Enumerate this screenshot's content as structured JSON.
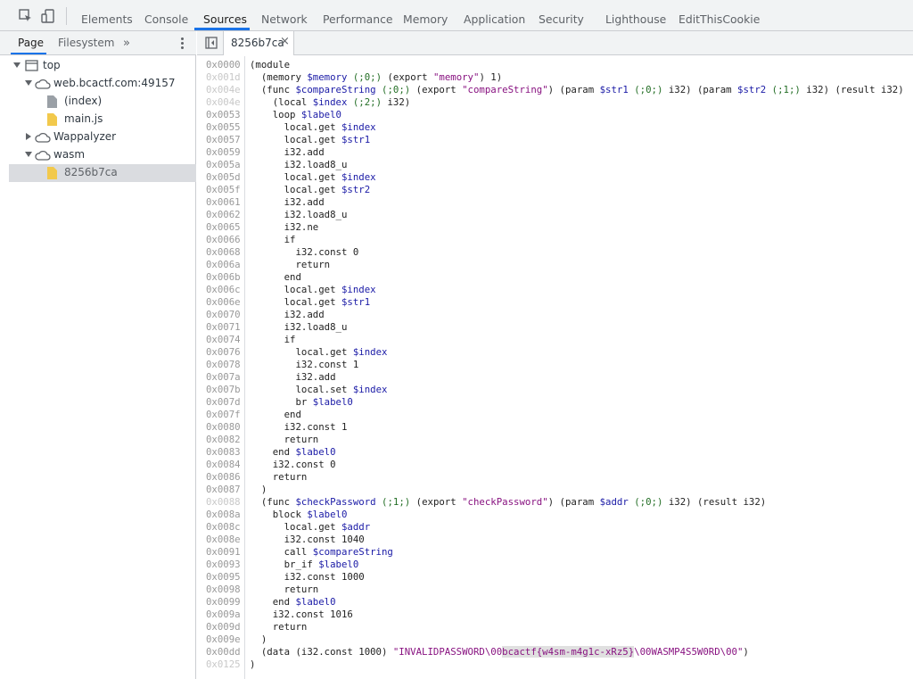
{
  "toolbar": {
    "tabs": [
      {
        "label": "Elements"
      },
      {
        "label": "Console"
      },
      {
        "label": "Sources"
      },
      {
        "label": "Network"
      },
      {
        "label": "Performance"
      },
      {
        "label": "Memory"
      },
      {
        "label": "Application"
      },
      {
        "label": "Security"
      },
      {
        "label": "Lighthouse"
      },
      {
        "label": "EditThisCookie"
      }
    ],
    "active_tab": "Sources",
    "accent_color": "#1a73e8"
  },
  "navigator": {
    "tabs": [
      {
        "label": "Page"
      },
      {
        "label": "Filesystem"
      }
    ],
    "more_label": "»",
    "tree": [
      {
        "label": "top",
        "icon": "frame-icon"
      },
      {
        "label": "web.bcactf.com:49157",
        "icon": "cloud-icon"
      },
      {
        "label": "(index)",
        "icon": "document-icon"
      },
      {
        "label": "main.js",
        "icon": "script-file-icon"
      },
      {
        "label": "Wappalyzer",
        "icon": "cloud-icon"
      },
      {
        "label": "wasm",
        "icon": "cloud-icon"
      },
      {
        "label": "8256b7ca",
        "icon": "script-file-icon"
      }
    ]
  },
  "editor": {
    "open_tab": "8256b7ca",
    "close_glyph": "×",
    "lines": [
      {
        "addr": "0x0000",
        "text": "(module"
      },
      {
        "addr": "0x001d",
        "text": "  (memory $memory (;0;) (export \"memory\") 1)"
      },
      {
        "addr": "0x004e",
        "text": "  (func $compareString (;0;) (export \"compareString\") (param $str1 (;0;) i32) (param $str2 (;1;) i32) (result i32)"
      },
      {
        "addr": "0x004e",
        "text": "    (local $index (;2;) i32)"
      },
      {
        "addr": "0x0053",
        "text": "    loop $label0"
      },
      {
        "addr": "0x0055",
        "text": "      local.get $index"
      },
      {
        "addr": "0x0057",
        "text": "      local.get $str1"
      },
      {
        "addr": "0x0059",
        "text": "      i32.add"
      },
      {
        "addr": "0x005a",
        "text": "      i32.load8_u"
      },
      {
        "addr": "0x005d",
        "text": "      local.get $index"
      },
      {
        "addr": "0x005f",
        "text": "      local.get $str2"
      },
      {
        "addr": "0x0061",
        "text": "      i32.add"
      },
      {
        "addr": "0x0062",
        "text": "      i32.load8_u"
      },
      {
        "addr": "0x0065",
        "text": "      i32.ne"
      },
      {
        "addr": "0x0066",
        "text": "      if"
      },
      {
        "addr": "0x0068",
        "text": "        i32.const 0"
      },
      {
        "addr": "0x006a",
        "text": "        return"
      },
      {
        "addr": "0x006b",
        "text": "      end"
      },
      {
        "addr": "0x006c",
        "text": "      local.get $index"
      },
      {
        "addr": "0x006e",
        "text": "      local.get $str1"
      },
      {
        "addr": "0x0070",
        "text": "      i32.add"
      },
      {
        "addr": "0x0071",
        "text": "      i32.load8_u"
      },
      {
        "addr": "0x0074",
        "text": "      if"
      },
      {
        "addr": "0x0076",
        "text": "        local.get $index"
      },
      {
        "addr": "0x0078",
        "text": "        i32.const 1"
      },
      {
        "addr": "0x007a",
        "text": "        i32.add"
      },
      {
        "addr": "0x007b",
        "text": "        local.set $index"
      },
      {
        "addr": "0x007d",
        "text": "        br $label0"
      },
      {
        "addr": "0x007f",
        "text": "      end"
      },
      {
        "addr": "0x0080",
        "text": "      i32.const 1"
      },
      {
        "addr": "0x0082",
        "text": "      return"
      },
      {
        "addr": "0x0083",
        "text": "    end $label0"
      },
      {
        "addr": "0x0084",
        "text": "    i32.const 0"
      },
      {
        "addr": "0x0086",
        "text": "    return"
      },
      {
        "addr": "0x0087",
        "text": "  )"
      },
      {
        "addr": "0x0088",
        "text": "  (func $checkPassword (;1;) (export \"checkPassword\") (param $addr (;0;) i32) (result i32)"
      },
      {
        "addr": "0x008a",
        "text": "    block $label0"
      },
      {
        "addr": "0x008c",
        "text": "      local.get $addr"
      },
      {
        "addr": "0x008e",
        "text": "      i32.const 1040"
      },
      {
        "addr": "0x0091",
        "text": "      call $compareString"
      },
      {
        "addr": "0x0093",
        "text": "      br_if $label0"
      },
      {
        "addr": "0x0095",
        "text": "      i32.const 1000"
      },
      {
        "addr": "0x0098",
        "text": "      return"
      },
      {
        "addr": "0x0099",
        "text": "    end $label0"
      },
      {
        "addr": "0x009a",
        "text": "    i32.const 1016"
      },
      {
        "addr": "0x009d",
        "text": "    return"
      },
      {
        "addr": "0x009e",
        "text": "  )"
      },
      {
        "addr": "0x00dd",
        "text": "  (data (i32.const 1000) \"INVALIDPASSWORD\\00bcactf{w4sm-m4g1c-xRz5}\\00WASMP4S5W0RD\\00\")"
      },
      {
        "addr": "0x0125",
        "text": ")"
      }
    ],
    "dim_address_rows": [
      1,
      2,
      3,
      35,
      48,
      49
    ],
    "highlight": "bcactf{w4sm-m4g1c-xRz5}"
  }
}
